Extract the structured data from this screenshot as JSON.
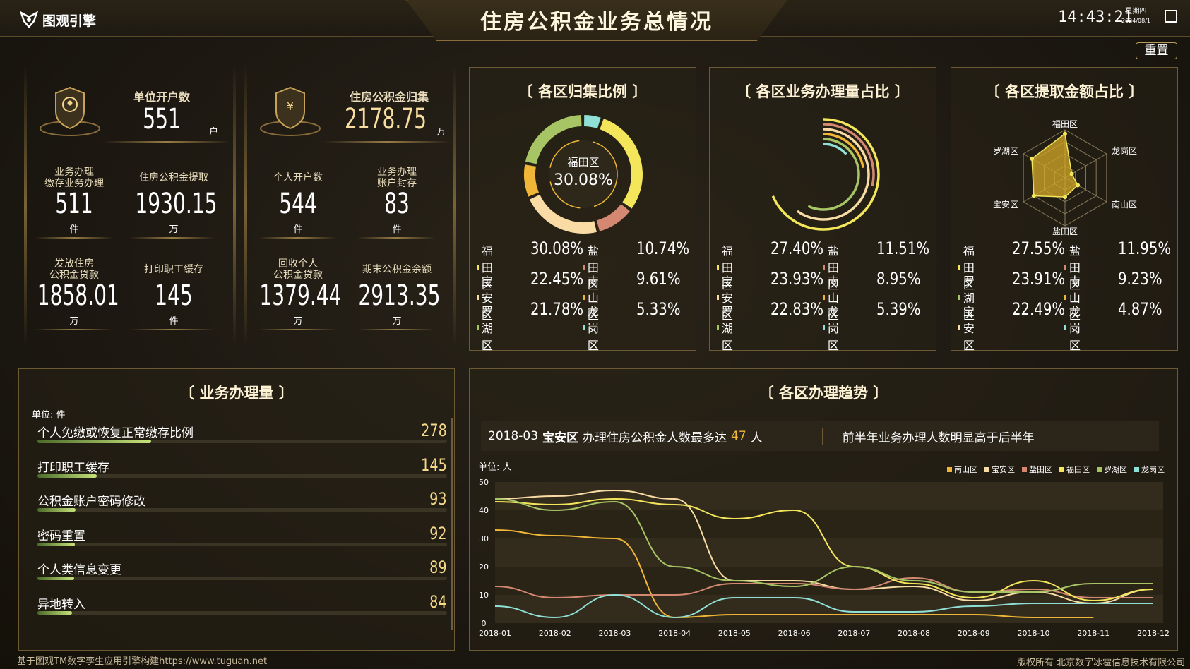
{
  "header": {
    "brand": "图观引擎",
    "title": "住房公积金业务总情况",
    "time": "14:43:21",
    "weekday": "星期四",
    "date": "2024/08/1",
    "reset": "重置"
  },
  "kpi_left": {
    "top_label": "单位开户数",
    "top_value": "551",
    "top_unit": "户",
    "items": [
      {
        "label1": "业务办理",
        "label2": "缴存业务办理",
        "value": "511",
        "unit": "件"
      },
      {
        "label1": "住房公积金提取",
        "label2": "",
        "value": "1930.15",
        "unit": "万"
      },
      {
        "label1": "发放住房",
        "label2": "公积金贷款",
        "value": "1858.01",
        "unit": "万"
      },
      {
        "label1": "打印职工缓存",
        "label2": "",
        "value": "145",
        "unit": "件"
      }
    ]
  },
  "kpi_right": {
    "top_label": "住房公积金归集",
    "top_value": "2178.75",
    "top_unit": "万",
    "items": [
      {
        "label1": "个人开户数",
        "label2": "",
        "value": "544",
        "unit": "件"
      },
      {
        "label1": "业务办理",
        "label2": "账户封存",
        "value": "83",
        "unit": "件"
      },
      {
        "label1": "回收个人",
        "label2": "公积金贷款",
        "value": "1379.44",
        "unit": "万"
      },
      {
        "label1": "期末公积金余额",
        "label2": "",
        "value": "2913.35",
        "unit": "万"
      }
    ]
  },
  "donut": {
    "title": "〔  各区归集比例  〕",
    "center_name": "福田区",
    "center_value": "30.08%",
    "legend": [
      {
        "name": "福田区",
        "value": "30.08%",
        "color": "#f3e65a"
      },
      {
        "name": "盐田区",
        "value": "10.74%",
        "color": "#d48872"
      },
      {
        "name": "宝安区",
        "value": "22.45%",
        "color": "#f8dba5"
      },
      {
        "name": "南山区",
        "value": "9.61%",
        "color": "#f0b637"
      },
      {
        "name": "罗湖区",
        "value": "21.78%",
        "color": "#a8c566"
      },
      {
        "name": "龙岗区",
        "value": "5.33%",
        "color": "#8fe0d6"
      }
    ]
  },
  "radial": {
    "title": "〔 各区业务办理量占比  〕",
    "legend": [
      {
        "name": "福田区",
        "value": "27.40%",
        "color": "#f3e65a"
      },
      {
        "name": "盐田区",
        "value": "11.51%",
        "color": "#d48872"
      },
      {
        "name": "宝安区",
        "value": "23.93%",
        "color": "#f8dba5"
      },
      {
        "name": "南山区",
        "value": "8.95%",
        "color": "#f0b637"
      },
      {
        "name": "罗湖区",
        "value": "22.83%",
        "color": "#a8c566"
      },
      {
        "name": "龙岗区",
        "value": "5.39%",
        "color": "#8fe0d6"
      }
    ]
  },
  "radar": {
    "title": "〔 各区提取金额占比 〕",
    "axes": [
      "福田区",
      "龙岗区",
      "南山区",
      "盐田区",
      "宝安区",
      "罗湖区"
    ],
    "legend": [
      {
        "name": "福田区",
        "value": "27.55%",
        "color": "#f3e65a"
      },
      {
        "name": "盐田区",
        "value": "11.95%",
        "color": "#d48872"
      },
      {
        "name": "罗湖区",
        "value": "23.91%",
        "color": "#a8c566"
      },
      {
        "name": "南山区",
        "value": "9.23%",
        "color": "#f0b637"
      },
      {
        "name": "宝安区",
        "value": "22.49%",
        "color": "#f8dba5"
      },
      {
        "name": "龙岗区",
        "value": "4.87%",
        "color": "#8fe0d6"
      }
    ]
  },
  "bars": {
    "title": "〔    业务办理量    〕",
    "unit": "单位: 件",
    "max": 1000,
    "items": [
      {
        "label": "个人免缴或恢复正常缴存比例",
        "value": "278"
      },
      {
        "label": "打印职工缓存",
        "value": "145"
      },
      {
        "label": "公积金账户密码修改",
        "value": "93"
      },
      {
        "label": "密码重置",
        "value": "92"
      },
      {
        "label": "个人类信息变更",
        "value": "89"
      },
      {
        "label": "异地转入",
        "value": "84"
      }
    ]
  },
  "trend": {
    "title": "〔  各区办理趋势  〕",
    "info_date": "2018-03",
    "info_region": "宝安区",
    "info_text": "办理住房公积金人数最多达",
    "info_num": "47",
    "info_unit": "人",
    "info_right": "前半年业务办理人数明显高于后半年",
    "unit": "单位: 人"
  },
  "chart_data": [
    {
      "type": "pie",
      "title": "",
      "categories": [
        "福田区",
        "盐田区",
        "宝安区",
        "南山区",
        "罗湖区",
        "龙岗区"
      ],
      "values": [
        30.08,
        10.74,
        22.45,
        9.61,
        21.78,
        5.33
      ]
    },
    {
      "type": "bar",
      "title": "",
      "categories": [
        "福田区",
        "盐田区",
        "宝安区",
        "南山区",
        "罗湖区",
        "龙岗区"
      ],
      "values": [
        27.4,
        11.51,
        23.93,
        8.95,
        22.83,
        5.39
      ]
    },
    {
      "type": "radar",
      "title": "",
      "categories": [
        "福田区",
        "龙岗区",
        "南山区",
        "盐田区",
        "宝安区",
        "罗湖区"
      ],
      "values": [
        27.55,
        4.87,
        9.23,
        11.95,
        22.49,
        23.91
      ],
      "max": 30
    },
    {
      "type": "line",
      "title": "",
      "x": [
        "2018-01",
        "2018-02",
        "2018-03",
        "2018-04",
        "2018-05",
        "2018-06",
        "2018-07",
        "2018-08",
        "2018-09",
        "2018-10",
        "2018-11",
        "2018-12"
      ],
      "ylim": [
        0,
        50
      ],
      "yticks": [
        0,
        10,
        20,
        30,
        40,
        50
      ],
      "ylabel": "单位: 人",
      "series": [
        {
          "name": "南山区",
          "color": "#f0b637",
          "values": [
            33,
            31,
            30,
            2,
            3,
            3,
            3,
            3,
            3,
            2,
            2,
            null
          ]
        },
        {
          "name": "宝安区",
          "color": "#f8dba5",
          "values": [
            44,
            45,
            47,
            44,
            15,
            15,
            12,
            13,
            8,
            11,
            7,
            12
          ]
        },
        {
          "name": "盐田区",
          "color": "#d48872",
          "values": [
            13,
            9,
            10,
            10,
            14,
            14,
            12,
            16,
            11,
            12,
            9,
            9
          ]
        },
        {
          "name": "福田区",
          "color": "#f3e65a",
          "values": [
            43,
            42,
            44,
            42,
            37,
            40,
            20,
            14,
            9,
            15,
            8,
            12
          ]
        },
        {
          "name": "罗湖区",
          "color": "#a8c566",
          "values": [
            44,
            40,
            43,
            20,
            15,
            13,
            20,
            15,
            11,
            11,
            14,
            14
          ]
        },
        {
          "name": "龙岗区",
          "color": "#8fe0d6",
          "values": [
            6,
            2,
            10,
            2,
            9,
            9,
            4,
            4,
            6,
            7,
            7,
            7
          ]
        }
      ]
    }
  ],
  "footer": {
    "left": "基于图观TM数字孪生应用引擎构建https://www.tuguan.net",
    "right": "版权所有  北京数字冰雹信息技术有限公司"
  }
}
